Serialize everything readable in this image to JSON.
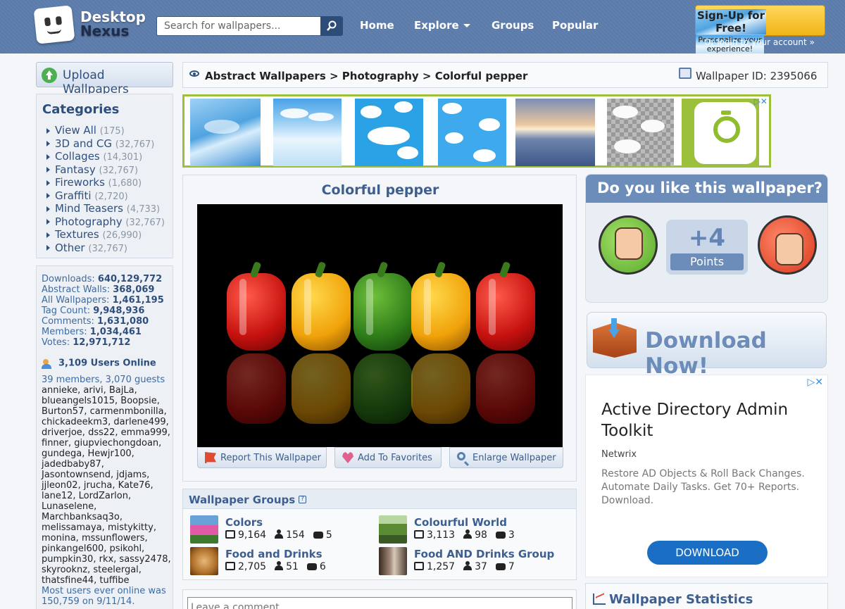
{
  "header": {
    "logo_line1": "Desktop",
    "logo_line2": "Nexus",
    "search_placeholder": "Search for wallpapers...",
    "nav": {
      "home": "Home",
      "explore": "Explore",
      "groups": "Groups",
      "popular": "Popular"
    },
    "signup_title": "Sign-Up for Free!",
    "signup_sub": "Personalize your experience!",
    "login_link": "Or login to your account »"
  },
  "sidebar": {
    "upload_label": "Upload Wallpapers",
    "categories_title": "Categories",
    "categories": [
      {
        "label": "View All",
        "count": "(175)"
      },
      {
        "label": "3D and CG",
        "count": "(32,767)"
      },
      {
        "label": "Collages",
        "count": "(14,301)"
      },
      {
        "label": "Fantasy",
        "count": "(32,767)"
      },
      {
        "label": "Fireworks",
        "count": "(1,680)"
      },
      {
        "label": "Graffiti",
        "count": "(2,720)"
      },
      {
        "label": "Mind Teasers",
        "count": "(4,733)"
      },
      {
        "label": "Photography",
        "count": "(32,767)"
      },
      {
        "label": "Textures",
        "count": "(26,990)"
      },
      {
        "label": "Other",
        "count": "(32,767)"
      }
    ],
    "stats": [
      {
        "label": "Downloads:",
        "value": "640,129,772"
      },
      {
        "label": "Abstract Walls:",
        "value": "368,069"
      },
      {
        "label": "All Wallpapers:",
        "value": "1,461,195"
      },
      {
        "label": "Tag Count:",
        "value": "9,948,936"
      },
      {
        "label": "Comments:",
        "value": "1,631,080"
      },
      {
        "label": "Members:",
        "value": "1,034,461"
      },
      {
        "label": "Votes:",
        "value": "12,971,712"
      }
    ],
    "users_online": "3,109 Users Online",
    "members_guests": "39 members, 3,070 guests",
    "online_names": "annieke, arivi, BajLa, blueangels1015, Boopsie, Burton57, carmenmbonilla, chickadeekm3, darlene499, driverjoe, dss22, emma999, finner, giupviechongdoan, gundega, Hewjr100, jadedbaby87, Jasontownsend, jdjams, jjleon02, jrucha, Kate76, lane12, LordZarlon, Lunaselene, Marchbanksaq3o, melissamaya, mistykitty, monina, mssunflowers, pinkangel600, psikohl, pumpkin30, rkx, sassy2478, skyrooknz, steelergal, thatsfine44, tuffibe",
    "most_online": "Most users ever online was 150,759 on 9/11/14."
  },
  "breadcrumb": {
    "path": "Abstract Wallpapers > Photography > Colorful pepper",
    "wallpaper_id": "Wallpaper ID: 2395066"
  },
  "ad_top": {
    "tag": "▷✕"
  },
  "wallpaper": {
    "title": "Colorful pepper",
    "report": "Report This Wallpaper",
    "favorite": "Add To Favorites",
    "enlarge": "Enlarge Wallpaper"
  },
  "groups": {
    "title": "Wallpaper Groups",
    "help": "?",
    "items": [
      {
        "name": "Colors",
        "walls": "9,164",
        "members": "154",
        "comments": "5"
      },
      {
        "name": "Colourful World",
        "walls": "3,113",
        "members": "98",
        "comments": "3"
      },
      {
        "name": "Food and Drinks",
        "walls": "2,705",
        "members": "51",
        "comments": "6"
      },
      {
        "name": "Food AND Drinks Group",
        "walls": "1,257",
        "members": "37",
        "comments": "7"
      }
    ]
  },
  "comment_placeholder": "Leave a comment",
  "vote": {
    "title": "Do you like this wallpaper?",
    "points": "+4",
    "points_label": "Points"
  },
  "download_now": "Download Now!",
  "ad_side": {
    "tag": "▷✕",
    "headline": "Active Directory Admin Toolkit",
    "brand": "Netwrix",
    "description": "Restore AD Objects & Roll Back Changes. Automate Daily Tasks. Get 70+ Reports. Download.",
    "cta": "DOWNLOAD"
  },
  "wallpaper_statistics": "Wallpaper Statistics",
  "colors": {
    "header_bg": "#5b7bab",
    "accent": "#3d5f8f",
    "signup": "#f2b417",
    "ad_border": "#9cc03b",
    "cta": "#1a6fc4"
  }
}
